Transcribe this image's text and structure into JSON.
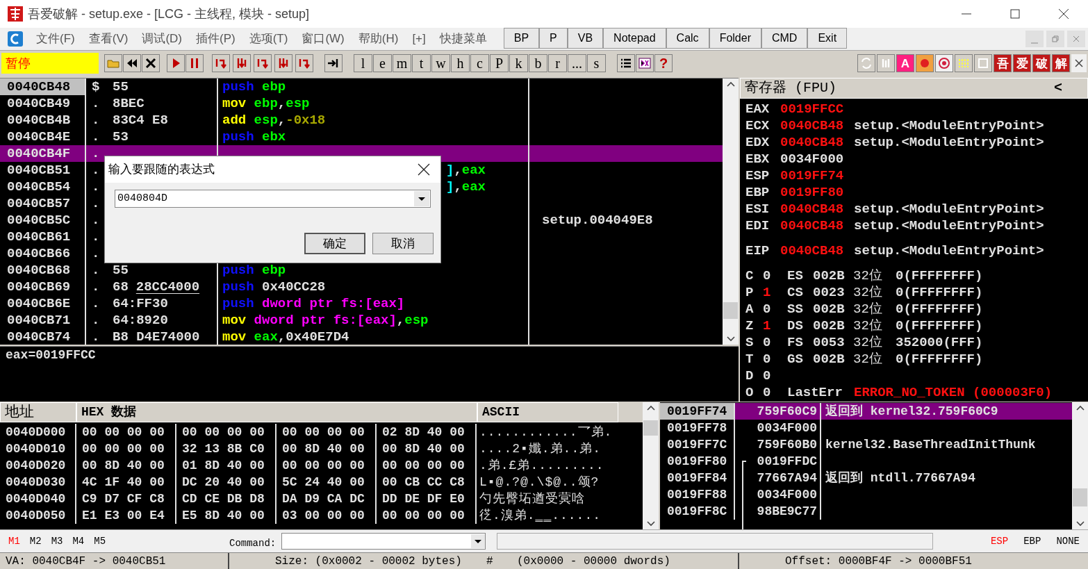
{
  "title_bar": {
    "title": "吾爱破解 - setup.exe - [LCG - 主线程, 模块 - setup]"
  },
  "menu": [
    "文件(F)",
    "查看(V)",
    "调试(D)",
    "插件(P)",
    "选项(T)",
    "窗口(W)",
    "帮助(H)",
    "[+]",
    "快捷菜单"
  ],
  "quick_buttons": [
    "BP",
    "P",
    "VB",
    "Notepad",
    "Calc",
    "Folder",
    "CMD",
    "Exit"
  ],
  "toolbar": {
    "status": "暂停",
    "letters": [
      "l",
      "e",
      "m",
      "t",
      "w",
      "h",
      "c",
      "P",
      "k",
      "b",
      "r",
      "...",
      "s"
    ],
    "help": "?",
    "font_key": "A",
    "brand_keys": [
      "吾",
      "爱",
      "破",
      "解"
    ]
  },
  "disasm": {
    "rows": [
      {
        "address": "0040CB48",
        "eip": true,
        "selected": false,
        "marker": "$",
        "hex": "55",
        "tokens": [
          {
            "text": "push ",
            "color": "#1010ff"
          },
          {
            "text": "ebp",
            "color": "#00ff00"
          }
        ]
      },
      {
        "address": "0040CB49",
        "eip": false,
        "selected": false,
        "marker": ".",
        "hex": "8BEC",
        "tokens": [
          {
            "text": "mov ",
            "color": "#ffff00"
          },
          {
            "text": "ebp",
            "color": "#00ff00"
          },
          {
            "text": ",",
            "color": "#e0e0e0"
          },
          {
            "text": "esp",
            "color": "#00ff00"
          }
        ]
      },
      {
        "address": "0040CB4B",
        "eip": false,
        "selected": false,
        "marker": ".",
        "hex": "83C4 E8",
        "tokens": [
          {
            "text": "add ",
            "color": "#ffff00"
          },
          {
            "text": "esp",
            "color": "#00ff00"
          },
          {
            "text": ",",
            "color": "#e0e0e0"
          },
          {
            "text": "-0x18",
            "color": "#a8a800"
          }
        ]
      },
      {
        "address": "0040CB4E",
        "eip": false,
        "selected": false,
        "marker": ".",
        "hex": "53",
        "tokens": [
          {
            "text": "push ",
            "color": "#1010ff"
          },
          {
            "text": "ebx",
            "color": "#00ff00"
          }
        ]
      },
      {
        "address": "0040CB4F",
        "eip": false,
        "selected": true,
        "marker": "."
      },
      {
        "address": "0040CB51",
        "eip": false,
        "selected": false,
        "marker": ".",
        "covered": true,
        "tokens": [
          {
            "text": "]",
            "color": "#00ffff"
          },
          {
            "text": ",",
            "color": "#e0e0e0"
          },
          {
            "text": "eax",
            "color": "#00ff00"
          }
        ]
      },
      {
        "address": "0040CB54",
        "eip": false,
        "selected": false,
        "marker": ".",
        "covered": true,
        "tokens": [
          {
            "text": "]",
            "color": "#00ffff"
          },
          {
            "text": ",",
            "color": "#e0e0e0"
          },
          {
            "text": "eax",
            "color": "#00ff00"
          }
        ]
      },
      {
        "address": "0040CB57",
        "eip": false,
        "selected": false,
        "marker": "."
      },
      {
        "address": "0040CB5C",
        "eip": false,
        "selected": false,
        "marker": ".",
        "comment": "setup.004049E8"
      },
      {
        "address": "0040CB61",
        "eip": false,
        "selected": false,
        "marker": "."
      },
      {
        "address": "0040CB66",
        "eip": false,
        "selected": false,
        "marker": "."
      },
      {
        "address": "0040CB68",
        "eip": false,
        "selected": false,
        "marker": ".",
        "hex": "55",
        "tokens": [
          {
            "text": "push ",
            "color": "#1010ff"
          },
          {
            "text": "ebp",
            "color": "#00ff00"
          }
        ]
      },
      {
        "address": "0040CB69",
        "eip": false,
        "selected": false,
        "marker": ".",
        "hex": "68",
        "hex_ref": "28CC4000",
        "tokens": [
          {
            "text": "push ",
            "color": "#1010ff"
          },
          {
            "text": "0x40CC28",
            "color": "#e0e0e0"
          }
        ]
      },
      {
        "address": "0040CB6E",
        "eip": false,
        "selected": false,
        "marker": ".",
        "hex": "64:FF30",
        "tokens": [
          {
            "text": "push ",
            "color": "#1010ff"
          },
          {
            "text": "dword ptr fs:[eax]",
            "color": "#ff00ff"
          }
        ]
      },
      {
        "address": "0040CB71",
        "eip": false,
        "selected": false,
        "marker": ".",
        "hex": "64:8920",
        "tokens": [
          {
            "text": "mov ",
            "color": "#ffff00"
          },
          {
            "text": "dword ptr fs:[eax]",
            "color": "#ff00ff"
          },
          {
            "text": ",",
            "color": "#e0e0e0"
          },
          {
            "text": "esp",
            "color": "#00ff00"
          }
        ]
      },
      {
        "address": "0040CB74",
        "eip": false,
        "selected": false,
        "marker": ".",
        "hex": "B8 D4E74000",
        "tokens": [
          {
            "text": "mov ",
            "color": "#ffff00"
          },
          {
            "text": "eax",
            "color": "#00ff00"
          },
          {
            "text": ",",
            "color": "#e0e0e0"
          },
          {
            "text": "0x40E7D4",
            "color": "#e0e0e0"
          }
        ]
      }
    ]
  },
  "info": "eax=0019FFCC",
  "dialog": {
    "title": "输入要跟随的表达式",
    "value": "0040804D",
    "buttons": [
      {
        "label": "确定",
        "default": true
      },
      {
        "label": "取消",
        "default": false
      }
    ]
  },
  "registers": {
    "title": "寄存器 (FPU)",
    "collapse": "<",
    "rows": [
      {
        "name": "EAX",
        "value": "0019FFCC",
        "changed": true
      },
      {
        "name": "ECX",
        "value": "0040CB48",
        "changed": true,
        "comment": "setup.<ModuleEntryPoint>"
      },
      {
        "name": "EDX",
        "value": "0040CB48",
        "changed": true,
        "comment": "setup.<ModuleEntryPoint>"
      },
      {
        "name": "EBX",
        "value": "0034F000",
        "changed": false
      },
      {
        "name": "ESP",
        "value": "0019FF74",
        "changed": true
      },
      {
        "name": "EBP",
        "value": "0019FF80",
        "changed": true
      },
      {
        "name": "ESI",
        "value": "0040CB48",
        "changed": true,
        "comment": "setup.<ModuleEntryPoint>"
      },
      {
        "name": "EDI",
        "value": "0040CB48",
        "changed": true,
        "comment": "setup.<ModuleEntryPoint>"
      }
    ],
    "eip": {
      "name": "EIP",
      "value": "0040CB48",
      "changed": true,
      "comment": "setup.<ModuleEntryPoint>"
    },
    "flags": [
      {
        "flag": "C",
        "value": "0",
        "changed": false,
        "seg": "ES",
        "selector": "002B",
        "bits": "32位",
        "limit": "0(FFFFFFFF)"
      },
      {
        "flag": "P",
        "value": "1",
        "changed": true,
        "seg": "CS",
        "selector": "0023",
        "bits": "32位",
        "limit": "0(FFFFFFFF)"
      },
      {
        "flag": "A",
        "value": "0",
        "changed": false,
        "seg": "SS",
        "selector": "002B",
        "bits": "32位",
        "limit": "0(FFFFFFFF)"
      },
      {
        "flag": "Z",
        "value": "1",
        "changed": true,
        "seg": "DS",
        "selector": "002B",
        "bits": "32位",
        "limit": "0(FFFFFFFF)"
      },
      {
        "flag": "S",
        "value": "0",
        "changed": false,
        "seg": "FS",
        "selector": "0053",
        "bits": "32位",
        "limit": "352000(FFF)"
      },
      {
        "flag": "T",
        "value": "0",
        "changed": false,
        "seg": "GS",
        "selector": "002B",
        "bits": "32位",
        "limit": "0(FFFFFFFF)"
      },
      {
        "flag": "D",
        "value": "0",
        "changed": false
      },
      {
        "flag": "O",
        "value": "0",
        "changed": false,
        "label": "LastErr",
        "error": "ERROR_NO_TOKEN (000003F0)"
      }
    ]
  },
  "dump": {
    "columns": [
      "地址",
      "HEX 数据",
      "ASCII"
    ],
    "rows": [
      {
        "address": "0040D000",
        "groups": [
          "00 00 00 00",
          "00 00 00 00",
          "00 00 00 00",
          "02 8D 40 00"
        ],
        "ascii": "............乛弟."
      },
      {
        "address": "0040D010",
        "groups": [
          "00 00 00 00",
          "32 13 8B C0",
          "00 8D 40 00",
          "00 8D 40 00"
        ],
        "ascii": "....2▪孅.弟..弟."
      },
      {
        "address": "0040D020",
        "groups": [
          "00 8D 40 00",
          "01 8D 40 00",
          "00 00 00 00",
          "00 00 00 00"
        ],
        "ascii": ".弟.£弟........."
      },
      {
        "address": "0040D030",
        "groups": [
          "4C 1F 40 00",
          "DC 20 40 00",
          "5C 24 40 00",
          "00 CB CC C8"
        ],
        "ascii": "L▪@.?@.\\$@..颂?"
      },
      {
        "address": "0040D040",
        "groups": [
          "C9 D7 CF C8",
          "CD CE DB D8",
          "DA D9 CA DC",
          "DD DE DF E0"
        ],
        "ascii": "勺先臀坧遒受蓂唅"
      },
      {
        "address": "0040D050",
        "groups": [
          "E1 E3 00 E4",
          "E5 8D 40 00",
          "03 00 00 00",
          "00 00 00 00"
        ],
        "ascii": "徔.溴弟.‗‗......"
      }
    ]
  },
  "stack": {
    "rows": [
      {
        "address": "0019FF74",
        "value": "759F60C9",
        "comment": "返回到 kernel32.759F60C9",
        "selected": true,
        "frame_start": false
      },
      {
        "address": "0019FF78",
        "value": "0034F000",
        "selected": false,
        "frame_start": false
      },
      {
        "address": "0019FF7C",
        "value": "759F60B0",
        "comment": "kernel32.BaseThreadInitThunk",
        "selected": false,
        "frame_start": false
      },
      {
        "address": "0019FF80",
        "value": "0019FFDC",
        "selected": false,
        "frame_start": true
      },
      {
        "address": "0019FF84",
        "value": "77667A94",
        "comment": "返回到 ntdll.77667A94",
        "selected": false,
        "frame_start": false
      },
      {
        "address": "0019FF88",
        "value": "0034F000",
        "selected": false,
        "frame_start": false
      },
      {
        "address": "0019FF8C",
        "value": "98BE9C77",
        "selected": false,
        "frame_start": false
      }
    ]
  },
  "command_bar": {
    "marks": [
      {
        "label": "M1",
        "selected": true
      },
      {
        "label": "M2",
        "selected": false
      },
      {
        "label": "M3",
        "selected": false
      },
      {
        "label": "M4",
        "selected": false
      },
      {
        "label": "M5",
        "selected": false
      }
    ],
    "label": "Command:",
    "follow": [
      {
        "label": "ESP",
        "selected": true
      },
      {
        "label": "EBP",
        "selected": false
      },
      {
        "label": "NONE",
        "selected": false
      }
    ]
  },
  "status_bar": {
    "va": "VA: 0040CB4F -> 0040CB51",
    "size": "Size: (0x0002 - 00002 bytes)",
    "hash": "#",
    "dwords": "(0x0000 - 00000 dwords)",
    "offset": "Offset: 0000BF4F -> 0000BF51"
  }
}
